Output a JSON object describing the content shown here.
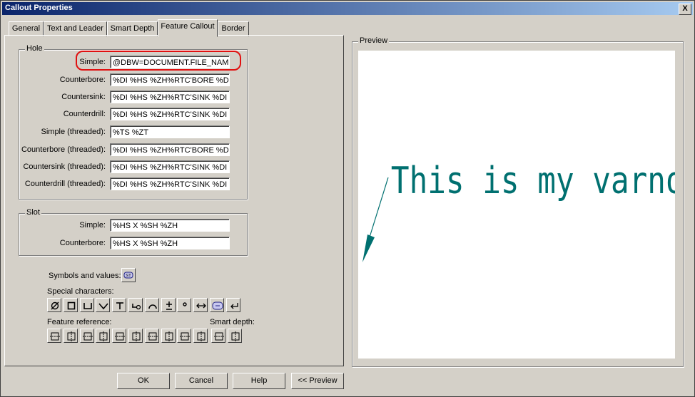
{
  "window": {
    "title": "Callout Properties",
    "close_label": "X"
  },
  "tabs": [
    {
      "label": "General"
    },
    {
      "label": "Text and Leader"
    },
    {
      "label": "Smart Depth"
    },
    {
      "label": "Feature Callout"
    },
    {
      "label": "Border"
    }
  ],
  "hole": {
    "group_label": "Hole",
    "rows": [
      {
        "label": "Simple:",
        "value": "@DBW=DOCUMENT.FILE_NAMI"
      },
      {
        "label": "Counterbore:",
        "value": "%DI %HS %ZH%RTC'BORE %DI %"
      },
      {
        "label": "Countersink:",
        "value": "%DI %HS %ZH%RTC'SINK %DI %"
      },
      {
        "label": "Counterdrill:",
        "value": "%DI %HS %ZH%RTC'SINK %DI %"
      },
      {
        "label": "Simple (threaded):",
        "value": "%TS %ZT"
      },
      {
        "label": "Counterbore (threaded):",
        "value": "%DI %HS %ZH%RTC'BORE %DI %"
      },
      {
        "label": "Countersink (threaded):",
        "value": "%DI %HS %ZH%RTC'SINK %DI %"
      },
      {
        "label": "Counterdrill (threaded):",
        "value": "%DI %HS %ZH%RTC'SINK %DI %"
      }
    ]
  },
  "slot": {
    "group_label": "Slot",
    "rows": [
      {
        "label": "Simple:",
        "value": "%HS X %SH %ZH"
      },
      {
        "label": "Counterbore:",
        "value": "%HS X %SH %ZH"
      }
    ]
  },
  "symbols": {
    "symbols_label": "Symbols and values:",
    "st_label": "ST",
    "special_label": "Special characters:",
    "special_buttons": [
      "diameter-icon",
      "square-icon",
      "counterbore-icon",
      "countersink-icon",
      "depth-icon",
      "arc-tangent-icon",
      "arc-icon",
      "plus-minus-icon",
      "degree-icon",
      "double-arrow-icon",
      "st-icon",
      "return-icon"
    ],
    "feature_label": "Feature reference:",
    "feature_buttons": [
      "feature-hole-icon",
      "feature-hole-side-icon",
      "feature-cbore-icon",
      "feature-cbore-side-icon",
      "feature-csink-icon",
      "feature-csink-side-icon",
      "feature-thread-icon",
      "feature-thread-side-icon",
      "feature-slot-icon",
      "feature-slot-side-icon"
    ],
    "smart_depth_label": "Smart depth:",
    "smart_depth_buttons": [
      "smart-depth-icon",
      "smart-depth-side-icon"
    ]
  },
  "preview": {
    "group_label": "Preview",
    "text": "This is my varnote",
    "text_color": "#007070"
  },
  "buttons": {
    "ok": "OK",
    "cancel": "Cancel",
    "help": "Help",
    "preview": "<< Preview"
  }
}
